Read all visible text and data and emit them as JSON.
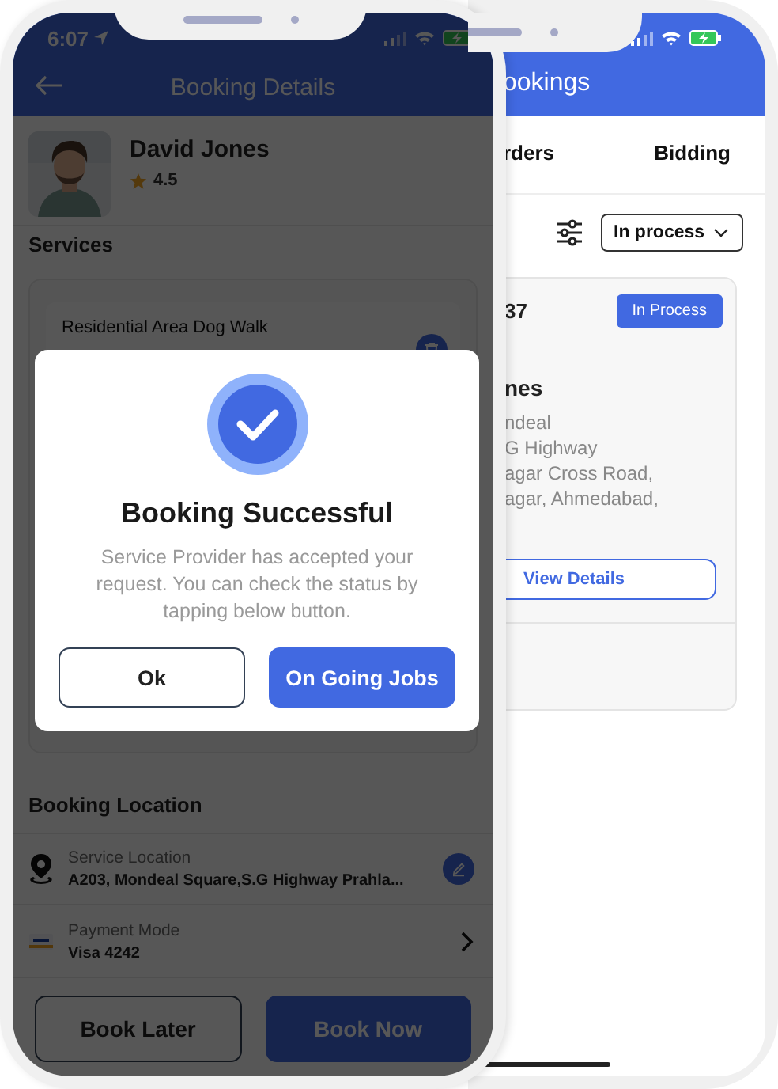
{
  "front_phone": {
    "status_bar": {
      "time": "6:07"
    },
    "header": {
      "title": "Booking Details"
    },
    "provider": {
      "name": "David Jones",
      "rating": "4.5"
    },
    "services": {
      "heading": "Services",
      "items": [
        {
          "name": "Residential Area Dog Walk"
        }
      ]
    },
    "booking_location": {
      "heading": "Booking Location",
      "rows": [
        {
          "kind": "location",
          "label": "Service Location",
          "value": "A203, Mondeal Square,S.G Highway Prahla..."
        },
        {
          "kind": "payment",
          "label": "Payment Mode",
          "value": "Visa 4242"
        }
      ]
    },
    "buttons": [
      {
        "label": "Book Later",
        "kind": "outline"
      },
      {
        "label": "Book Now",
        "kind": "primary"
      }
    ],
    "dialog": {
      "title": "Booking Successful",
      "message": "Service Provider has accepted your request. You can check the status by tapping below button.",
      "buttons": [
        {
          "label": "Ok",
          "kind": "outline"
        },
        {
          "label": "On Going Jobs",
          "kind": "primary"
        }
      ]
    }
  },
  "back_phone": {
    "header": {
      "title": "ookings"
    },
    "tabs": [
      {
        "label": "rders"
      },
      {
        "label": "Bidding"
      }
    ],
    "filter": {
      "value": "In process"
    },
    "booking": {
      "number": "37",
      "status": "In Process",
      "name": "nes",
      "address_lines": [
        "ndeal",
        "G Highway",
        "agar Cross Road,",
        "agar, Ahmedabad,"
      ],
      "action": "View Details"
    }
  }
}
